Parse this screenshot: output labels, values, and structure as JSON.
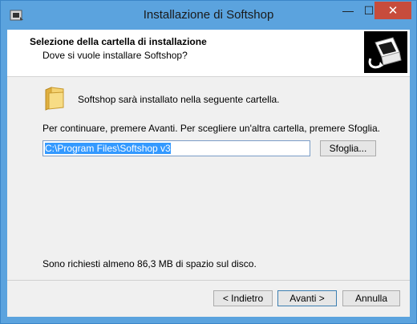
{
  "window": {
    "title": "Installazione di Softshop"
  },
  "title_controls": {
    "minimize": "—",
    "maximize": "☐",
    "close": "✕"
  },
  "header": {
    "title": "Selezione della cartella di installazione",
    "subtitle": "Dove si vuole installare Softshop?"
  },
  "body": {
    "info": "Softshop sarà installato nella seguente cartella.",
    "hint": "Per continuare, premere Avanti. Per scegliere un'altra cartella, premere Sfoglia.",
    "path_value": "C:\\Program Files\\Softshop v3",
    "browse_label": "Sfoglia...",
    "space_note": "Sono richiesti almeno 86,3 MB di spazio sul disco."
  },
  "footer": {
    "back_label": "< Indietro",
    "next_label": "Avanti >",
    "cancel_label": "Annulla"
  },
  "colors": {
    "titlebar": "#5ba3de",
    "close_button": "#c74c3c",
    "selection": "#3399ff"
  }
}
